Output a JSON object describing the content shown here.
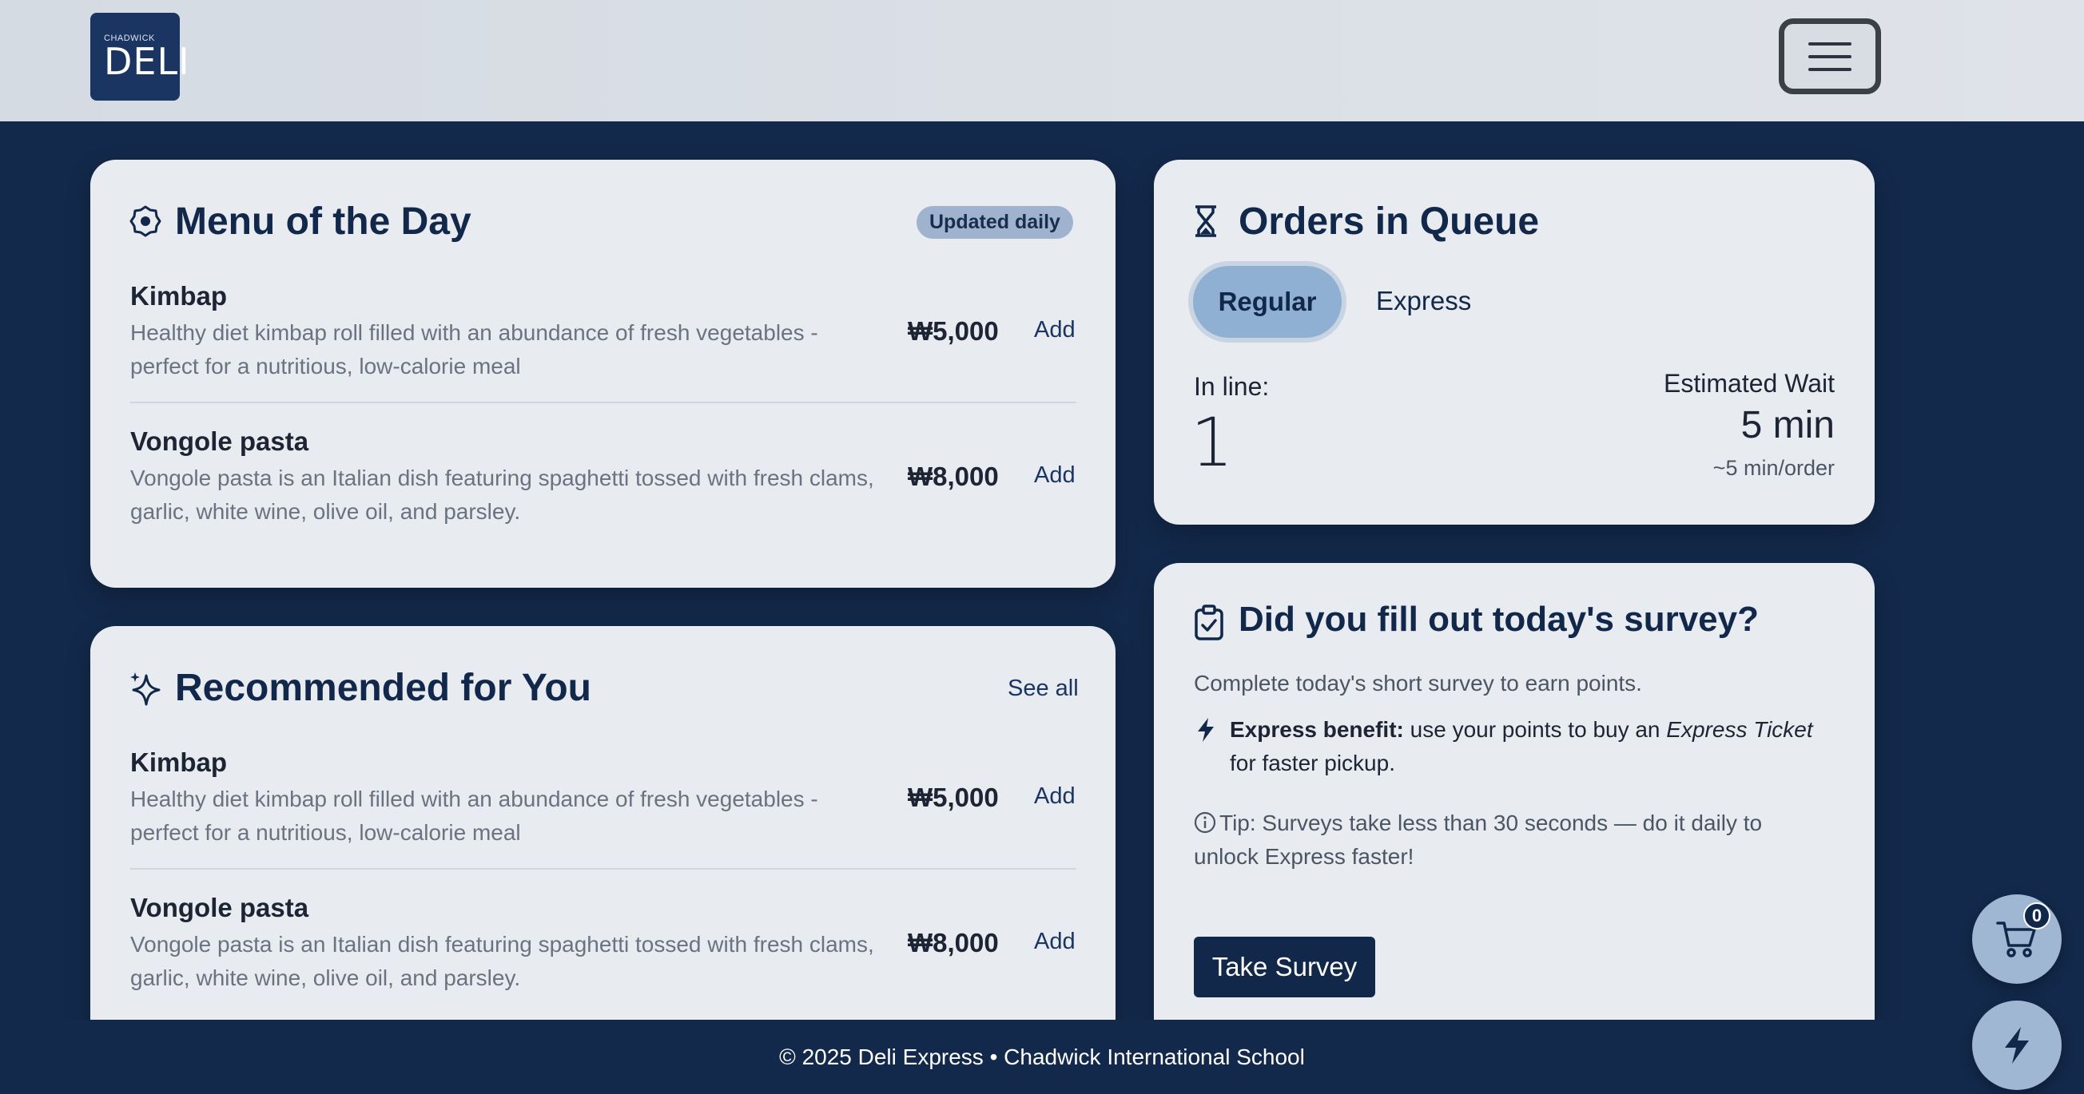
{
  "logo": {
    "small_text": "CHADWICK",
    "big_text": "DELI"
  },
  "menu_of_day": {
    "title": "Menu of the Day",
    "badge": "Updated daily",
    "items": [
      {
        "name": "Kimbap",
        "description": "Healthy diet kimbap roll filled with an abundance of fresh vegetables - perfect for a nutritious, low-calorie meal",
        "price": "₩5,000",
        "add_label": "Add"
      },
      {
        "name": "Vongole pasta",
        "description": "Vongole pasta is an Italian dish featuring spaghetti tossed with fresh clams, garlic, white wine, olive oil, and parsley.",
        "price": "₩8,000",
        "add_label": "Add"
      }
    ]
  },
  "recommended": {
    "title": "Recommended for You",
    "see_all": "See all",
    "items": [
      {
        "name": "Kimbap",
        "description": "Healthy diet kimbap roll filled with an abundance of fresh vegetables - perfect for a nutritious, low-calorie meal",
        "price": "₩5,000",
        "add_label": "Add"
      },
      {
        "name": "Vongole pasta",
        "description": "Vongole pasta is an Italian dish featuring spaghetti tossed with fresh clams, garlic, white wine, olive oil, and parsley.",
        "price": "₩8,000",
        "add_label": "Add"
      }
    ]
  },
  "queue": {
    "title": "Orders in Queue",
    "tabs": [
      "Regular",
      "Express"
    ],
    "active_tab": "Regular",
    "in_line_label": "In line:",
    "in_line_value": "1",
    "wait_label": "Estimated Wait",
    "wait_value": "5 min",
    "wait_rate": "~5 min/order"
  },
  "survey": {
    "title": "Did you fill out today's survey?",
    "intro": "Complete today's short survey to earn points.",
    "benefit_bold": "Express benefit:",
    "benefit_text": " use your points to buy an ",
    "benefit_italic": "Express Ticket",
    "benefit_end": " for faster pickup.",
    "tip": "Tip: Surveys take less than 30 seconds — do it daily to unlock Express faster!",
    "button": "Take Survey"
  },
  "footer": {
    "text": "© 2025 Deli Express • Chadwick International School"
  },
  "cart": {
    "count": "0"
  },
  "colors": {
    "navy": "#12284a",
    "background": "#13294b",
    "card": "#e8ebf0",
    "accent": "#8fb0d2"
  }
}
